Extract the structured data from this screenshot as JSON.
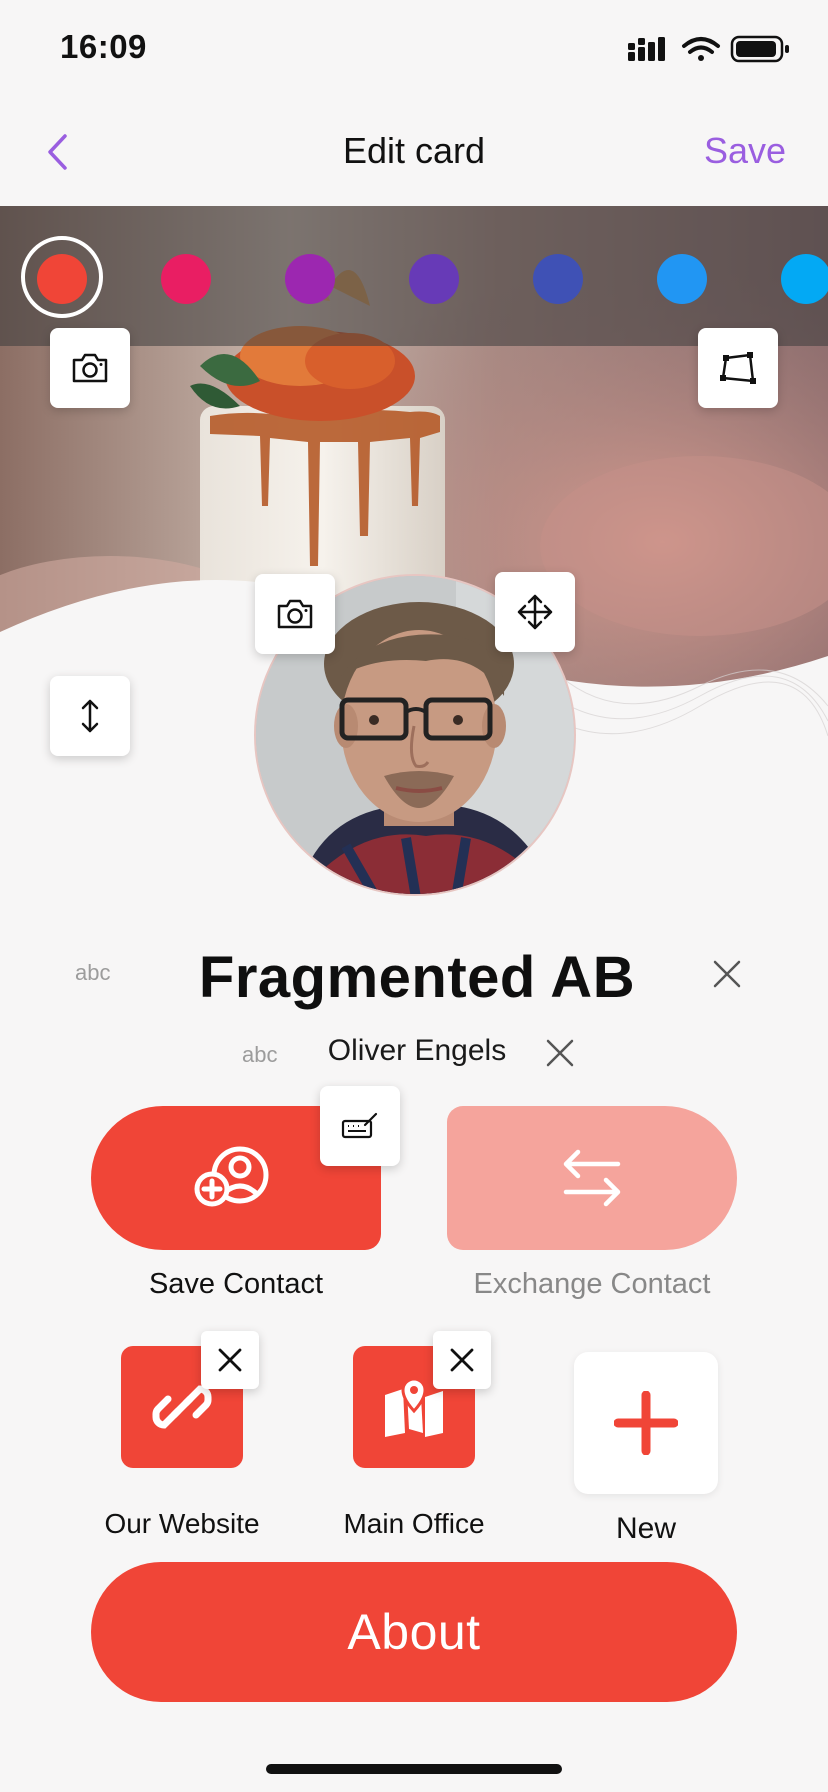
{
  "status_bar": {
    "time": "16:09"
  },
  "nav": {
    "title": "Edit card",
    "save_label": "Save"
  },
  "colors": {
    "accent": "#9a5ee0",
    "brand_red": "#f04537",
    "brand_red_light": "#f5a49c",
    "swatches": [
      "#f04537",
      "#e91e63",
      "#9c27b0",
      "#673ab7",
      "#3f51b5",
      "#2196f3",
      "#03a9f4"
    ],
    "selected_swatch": 0
  },
  "card": {
    "company_hint": "abc",
    "company_name": "Fragmented AB",
    "person_hint": "abc",
    "person_name": "Oliver Engels"
  },
  "actions": {
    "save_contact": "Save Contact",
    "exchange_contact": "Exchange Contact"
  },
  "links": [
    {
      "label": "Our Website",
      "icon": "link-icon"
    },
    {
      "label": "Main Office",
      "icon": "map-icon"
    }
  ],
  "new_link_label": "New",
  "about_label": "About"
}
